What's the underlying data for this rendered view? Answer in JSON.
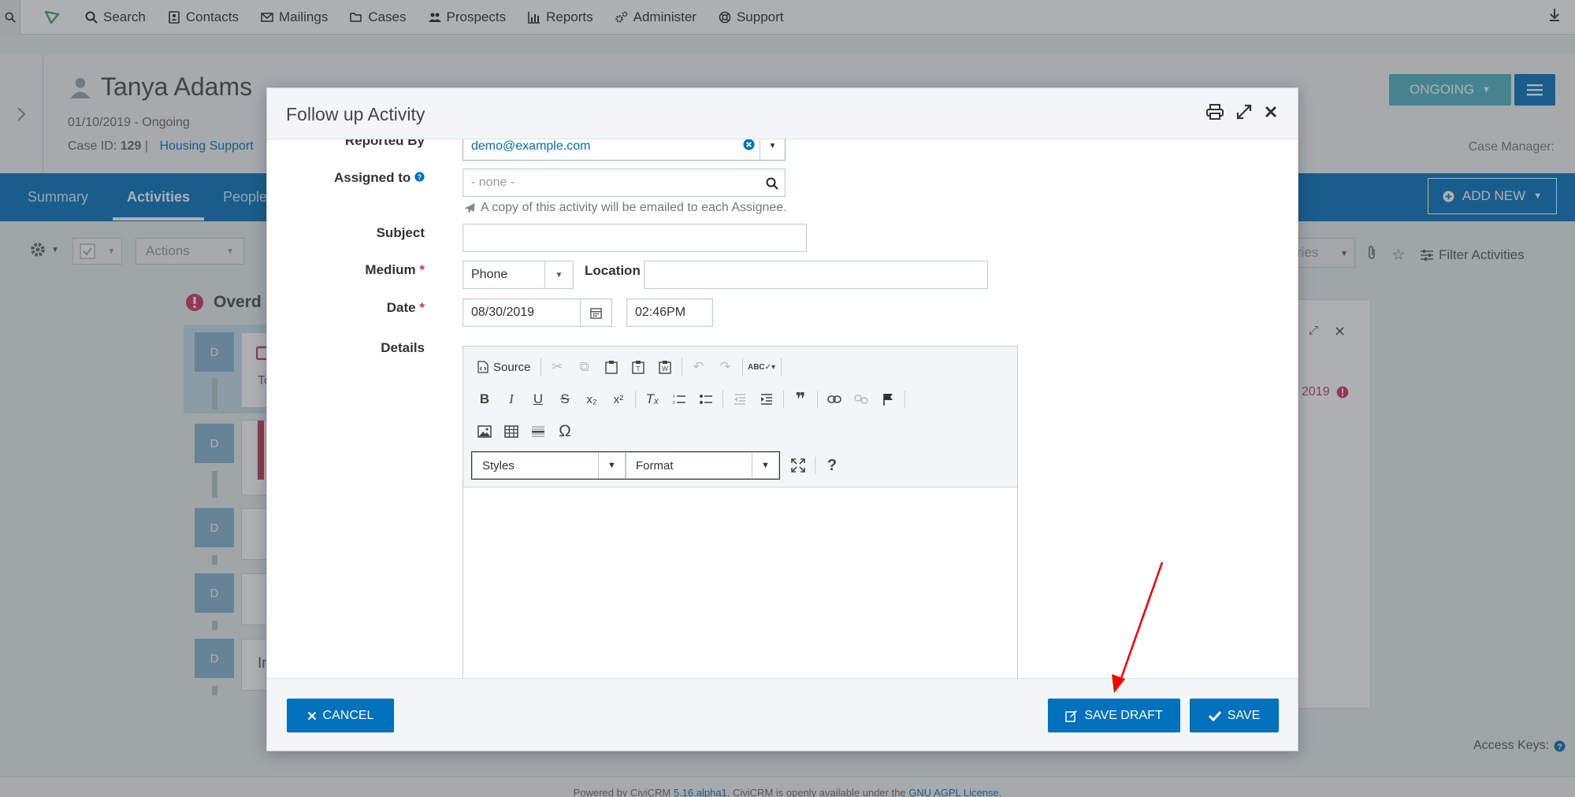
{
  "nav": {
    "items": [
      "Search",
      "Contacts",
      "Mailings",
      "Cases",
      "Prospects",
      "Reports",
      "Administer",
      "Support"
    ]
  },
  "case": {
    "contact_name": "Tanya Adams",
    "date_status": "01/10/2019 - Ongoing",
    "case_id_label": "Case ID:",
    "case_id": "129",
    "case_type": "Housing Support",
    "status_button": "ONGOING",
    "case_manager_label": "Case Manager:"
  },
  "tabs": {
    "items": [
      "Summary",
      "Activities",
      "People"
    ],
    "active": "Activities",
    "add_new": "ADD NEW"
  },
  "toolbar": {
    "actions_label": "Actions",
    "category_partial": "ries",
    "filter_label": "Filter Activities"
  },
  "timeline": {
    "overdue_label": "Overd",
    "badge_letter": "D",
    "card_partial_1": "To",
    "card_partial_2": "In"
  },
  "right_panel": {
    "date_partial": "2019"
  },
  "dialog": {
    "title": "Follow up Activity",
    "fields": {
      "reported_by_label": "Reported By",
      "reported_by_value": "demo@example.com",
      "assigned_to_label": "Assigned to",
      "assigned_to_placeholder": "- none -",
      "assignee_note": "A copy of this activity will be emailed to each Assignee.",
      "subject_label": "Subject",
      "subject_value": "",
      "medium_label": "Medium",
      "medium_value": "Phone",
      "location_label": "Location",
      "location_value": "",
      "date_label": "Date",
      "date_value": "08/30/2019",
      "time_value": "02:46PM",
      "details_label": "Details"
    },
    "editor": {
      "source_label": "Source",
      "styles_label": "Styles",
      "format_label": "Format",
      "help_glyph": "?",
      "omega_glyph": "Ω",
      "quote_glyph": "❞"
    },
    "buttons": {
      "cancel": "CANCEL",
      "save_draft": "SAVE DRAFT",
      "save": "SAVE"
    }
  },
  "access_keys": "Access Keys:",
  "footer": {
    "prefix": "Powered by CiviCRM ",
    "version": "5.16.alpha1",
    "middle": ". CiviCRM is openly available under the ",
    "license": "GNU AGPL License",
    "suffix": "."
  },
  "colors": {
    "primary": "#0071bd",
    "status": "#4fb2c7",
    "danger": "#cf3458",
    "annotation_arrow": "#ff0000"
  }
}
